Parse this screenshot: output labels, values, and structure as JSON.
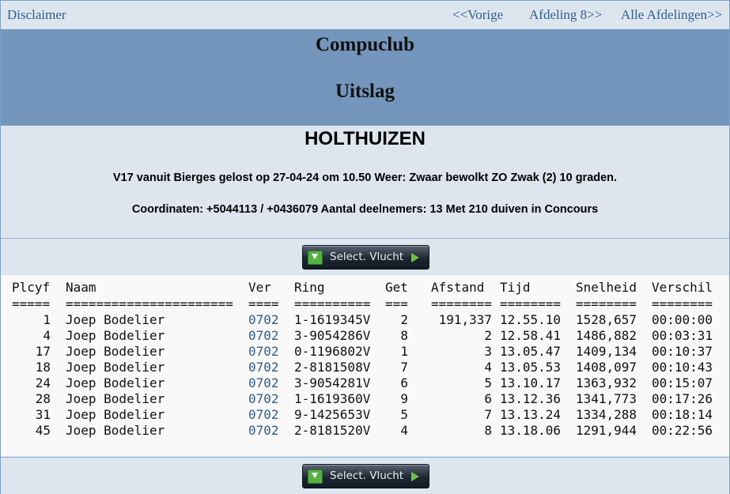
{
  "nav": {
    "disclaimer": "Disclaimer",
    "prev": "<<Vorige",
    "next": "Afdeling 8>>",
    "all": "Alle Afdelingen>>"
  },
  "header": {
    "club": "Compuclub",
    "title": "Uitslag"
  },
  "race": {
    "place": "HOLTHUIZEN",
    "line1": "V17 vanuit Bierges gelost op 27-04-24 om 10.50 Weer: Zwaar bewolkt ZO Zwak (2) 10 graden.",
    "line2": "Coordinaten: +5044113 / +0436079 Aantal deelnemers: 13 Met 210 duiven in Concours"
  },
  "button": {
    "label": "Select. Vlucht",
    "icon_left": "download-icon",
    "icon_right": "arrow-right-icon"
  },
  "table": {
    "headers": [
      "Plcyf",
      "Naam",
      "Ver",
      "Ring",
      "Get",
      "Afstand",
      "Tijd",
      "Snelheid",
      "Verschil"
    ],
    "underlines": [
      "=====",
      "======================",
      "====",
      "==========",
      "===",
      "========",
      "========",
      "========",
      "========"
    ],
    "rows": [
      [
        "1",
        "Joep Bodelier",
        "0702",
        "1-1619345V",
        "2",
        "191,337",
        "12.55.10",
        "1528,657",
        "00:00:00"
      ],
      [
        "4",
        "Joep Bodelier",
        "0702",
        "3-9054286V",
        "8",
        "2",
        "12.58.41",
        "1486,882",
        "00:03:31"
      ],
      [
        "17",
        "Joep Bodelier",
        "0702",
        "0-1196802V",
        "1",
        "3",
        "13.05.47",
        "1409,134",
        "00:10:37"
      ],
      [
        "18",
        "Joep Bodelier",
        "0702",
        "2-8181508V",
        "7",
        "4",
        "13.05.53",
        "1408,097",
        "00:10:43"
      ],
      [
        "24",
        "Joep Bodelier",
        "0702",
        "3-9054281V",
        "6",
        "5",
        "13.10.17",
        "1363,932",
        "00:15:07"
      ],
      [
        "28",
        "Joep Bodelier",
        "0702",
        "1-1619360V",
        "9",
        "6",
        "13.12.36",
        "1341,773",
        "00:17:26"
      ],
      [
        "31",
        "Joep Bodelier",
        "0702",
        "9-1425653V",
        "5",
        "7",
        "13.13.24",
        "1334,288",
        "00:18:14"
      ],
      [
        "45",
        "Joep Bodelier",
        "0702",
        "2-8181520V",
        "4",
        "8",
        "13.18.06",
        "1291,944",
        "00:22:56"
      ]
    ]
  },
  "colors": {
    "header_band": "#7496bc",
    "page_bg": "#dde6ef",
    "link": "#2f5d8c",
    "table_bg": "#f9f9f9"
  }
}
